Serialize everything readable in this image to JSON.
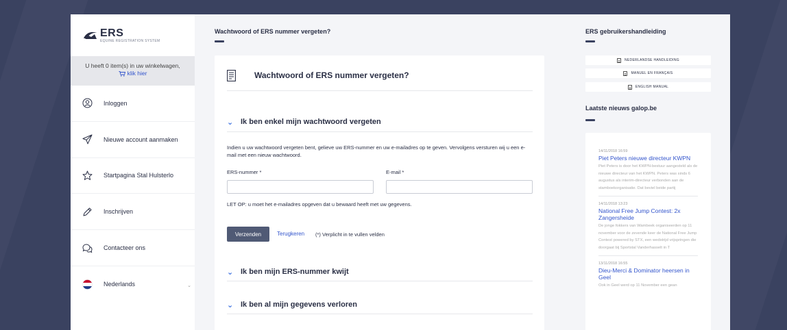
{
  "logo": {
    "name": "ERS",
    "subtitle": "EQUINE REGISTRATION SYSTEM"
  },
  "cart": {
    "text": "U heeft 0 item(s) in uw winkelwagen,",
    "link_label": "klik hier"
  },
  "nav": {
    "items": [
      {
        "label": "Inloggen",
        "icon": "user-circle-icon"
      },
      {
        "label": "Nieuwe account aanmaken",
        "icon": "send-icon"
      },
      {
        "label": "Startpagina Stal Hulsterlo",
        "icon": "star-icon"
      },
      {
        "label": "Inschrijven",
        "icon": "pencil-icon"
      },
      {
        "label": "Contacteer ons",
        "icon": "chat-bubbles-icon"
      },
      {
        "label": "Nederlands",
        "icon": "flag-nl-icon"
      }
    ]
  },
  "main": {
    "page_title": "Wachtwoord of ERS nummer vergeten?",
    "card_title": "Wachtwoord of ERS nummer vergeten?",
    "sections": [
      {
        "title": "Ik ben enkel mijn wachtwoord vergeten",
        "expanded": true
      },
      {
        "title": "Ik ben mijn ERS-nummer kwijt",
        "expanded": false
      },
      {
        "title": "Ik ben al mijn gegevens verloren",
        "expanded": false
      }
    ],
    "form": {
      "intro": "Indien u uw wachtwoord vergeten bent, gelieve uw ERS-nummer en uw e-mailadres op te geven. Vervolgens versturen wij u een e-mail met een nieuw wachtwoord.",
      "ers_label": "ERS-nummer *",
      "ers_value": "",
      "email_label": "E-mail *",
      "email_value": "",
      "note": "LET OP: u moet het e-mailadres opgeven dat u bewaard heeft met uw gegevens.",
      "submit_label": "Verzenden",
      "back_label": "Terugkeren",
      "required_note": "(*) Verplicht in te vullen velden"
    }
  },
  "right": {
    "manual_title": "ERS gebruikershandleiding",
    "manuals": [
      "NEDERLANDSE HANDLEIDING",
      "MANUEL EN FRANÇAIS",
      "ENGLISH MANUAL"
    ],
    "news_title": "Laatste nieuws galop.be",
    "news": [
      {
        "date": "14/11/2018 16:59",
        "title": "Piet Peters nieuwe directeur KWPN",
        "text": "Piet Peters is door het KWPN-bestuur aangesteld als de nieuwe directeur van het KWPN. Peters was sinds 6 augustus als interim-directeur verbonden aan de stamboekorganisatie. Dat beviel beide partij"
      },
      {
        "date": "14/11/2018 13:23",
        "title": "National Free Jump Contest: 2x Zangersheide",
        "text": "De jonge fokkers van Wambeek organiseerden op 11 november voor de zevende keer de National Free Jump Contest powered by STX, een wedstrijd vrijspringen die doorgaat bij Sportstal Vanderhasselt in T"
      },
      {
        "date": "13/11/2018 16:55",
        "title": "Dieu-Merci & Dominator heersen in Geel",
        "text": "Ook in Geel werd op 11 November een gean"
      }
    ]
  },
  "colors": {
    "accent": "#3a6fe0",
    "link": "#3355cc",
    "button": "#505a75",
    "background": "#3a4260"
  }
}
